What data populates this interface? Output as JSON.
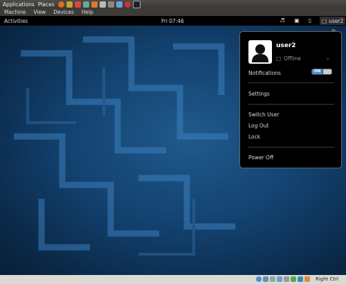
{
  "host_panel": {
    "applications": "Applications",
    "places": "Places"
  },
  "vbox_menu": {
    "items": [
      "Machine",
      "View",
      "Devices",
      "Help"
    ]
  },
  "gnome_bar": {
    "activities": "Activities",
    "clock": "Fri 07:46",
    "user": "user2"
  },
  "user_menu": {
    "username": "user2",
    "status": "Offline",
    "notifications_label": "Notifications",
    "notifications_toggle": "ON",
    "settings": "Settings",
    "switch_user": "Switch User",
    "log_out": "Log Out",
    "lock": "Lock",
    "power_off": "Power Off"
  },
  "statusbar": {
    "host_key": "Right Ctrl"
  },
  "colors": {
    "toggle_on": "#4a90d9",
    "desktop_base": "#134270"
  }
}
